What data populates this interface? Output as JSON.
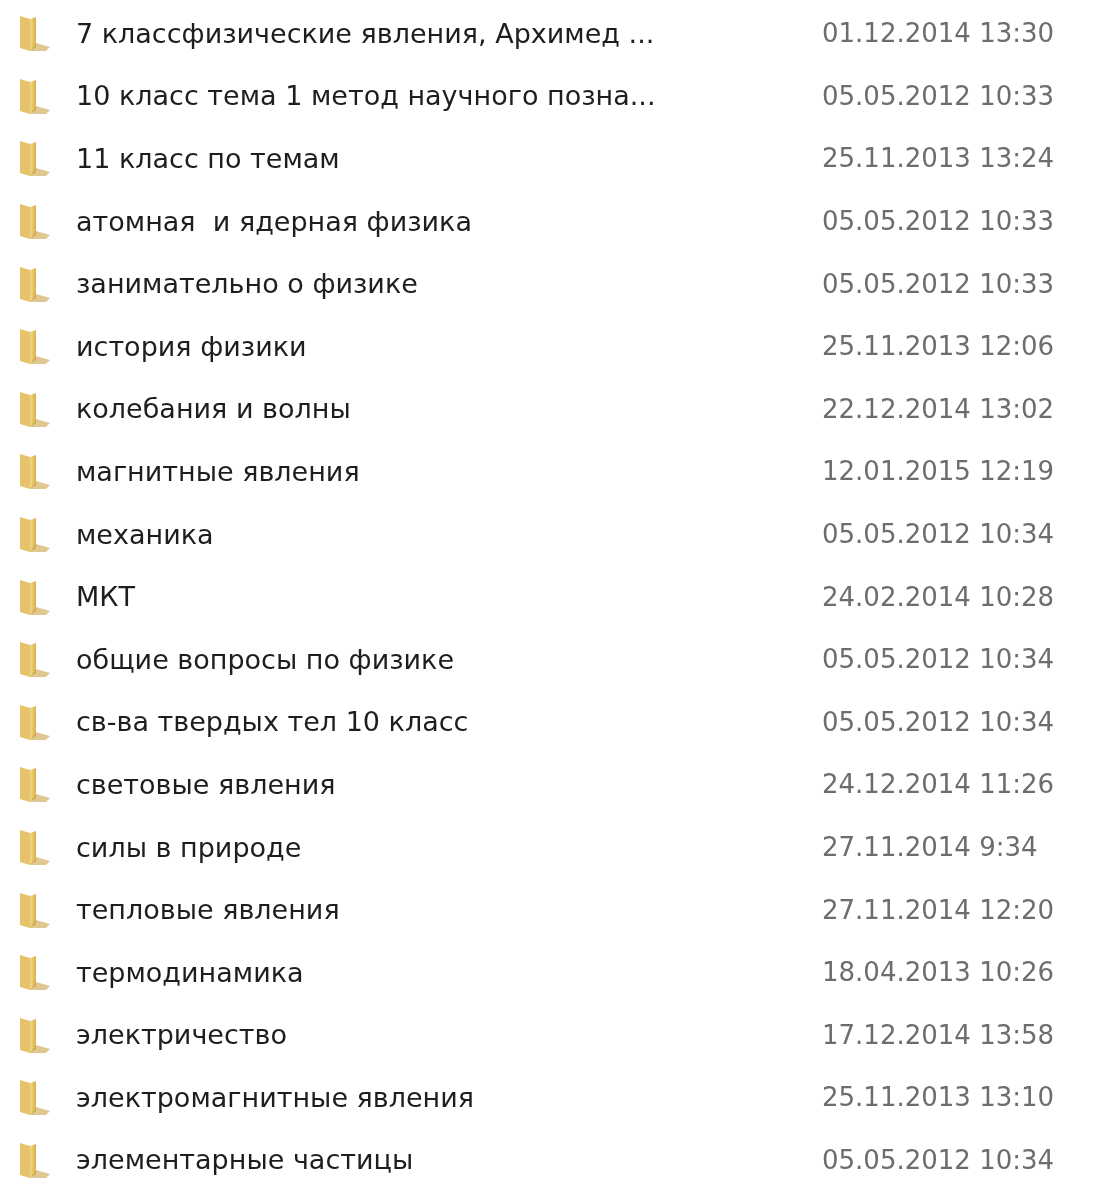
{
  "files": [
    {
      "name": "7 классфизические явления, Архимед ...",
      "modified": "01.12.2014 13:30"
    },
    {
      "name": "10 класс тема 1 метод научного позна...",
      "modified": "05.05.2012 10:33"
    },
    {
      "name": "11 класс по темам",
      "modified": "25.11.2013 13:24"
    },
    {
      "name": "атомная  и ядерная физика",
      "modified": "05.05.2012 10:33"
    },
    {
      "name": "занимательно о физике",
      "modified": "05.05.2012 10:33"
    },
    {
      "name": "история физики",
      "modified": "25.11.2013 12:06"
    },
    {
      "name": "колебания и волны",
      "modified": "22.12.2014 13:02"
    },
    {
      "name": "магнитные явления",
      "modified": "12.01.2015 12:19"
    },
    {
      "name": "механика",
      "modified": "05.05.2012 10:34"
    },
    {
      "name": "МКТ",
      "modified": "24.02.2014 10:28"
    },
    {
      "name": "общие вопросы по физике",
      "modified": "05.05.2012 10:34"
    },
    {
      "name": "св-ва твердых тел 10 класс",
      "modified": "05.05.2012 10:34"
    },
    {
      "name": "световые явления",
      "modified": "24.12.2014 11:26"
    },
    {
      "name": "силы в природе",
      "modified": "27.11.2014 9:34"
    },
    {
      "name": "тепловые явления",
      "modified": "27.11.2014 12:20"
    },
    {
      "name": "термодинамика",
      "modified": "18.04.2013 10:26"
    },
    {
      "name": "электричество",
      "modified": "17.12.2014 13:58"
    },
    {
      "name": "электромагнитные явления",
      "modified": "25.11.2013 13:10"
    },
    {
      "name": "элементарные частицы",
      "modified": "05.05.2012 10:34"
    }
  ]
}
